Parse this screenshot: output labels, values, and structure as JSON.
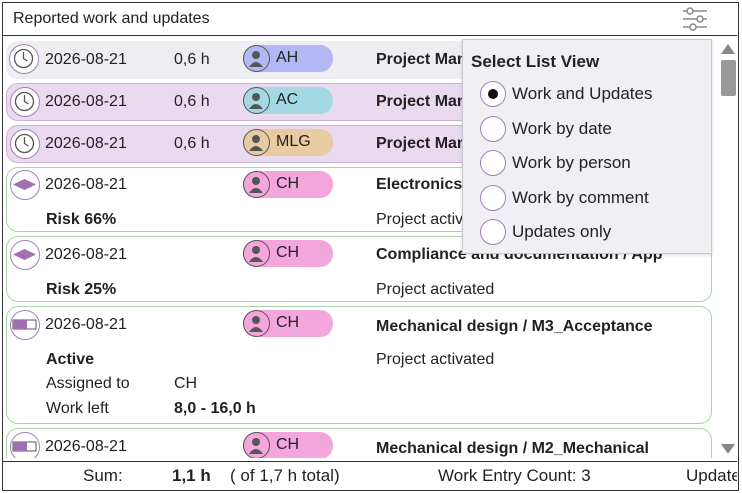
{
  "header": {
    "title": "Reported work and updates",
    "filter_icon": "filter-sliders-icon"
  },
  "rows": [
    {
      "kind": "work",
      "icon": "clock-icon",
      "date": "2026-08-21",
      "hours": "0,6 h",
      "initials": "AH",
      "pill_color": "#b3b8f4",
      "title": "Project Management"
    },
    {
      "kind": "work",
      "icon": "clock-icon",
      "date": "2026-08-21",
      "hours": "0,6 h",
      "initials": "AC",
      "pill_color": "#a3d9e3",
      "title": "Project Management"
    },
    {
      "kind": "work",
      "icon": "clock-icon",
      "date": "2026-08-21",
      "hours": "0,6 h",
      "initials": "MLG",
      "pill_color": "#e8cba0",
      "title": "Project Management"
    },
    {
      "kind": "update",
      "icon": "diamond-icon",
      "date": "2026-08-21",
      "initials": "CH",
      "pill_color": "#f2a6dc",
      "title": "Electronics",
      "status": "Risk 66%",
      "comment": "Project activated"
    },
    {
      "kind": "update",
      "icon": "diamond-icon",
      "date": "2026-08-21",
      "initials": "CH",
      "pill_color": "#f2a6dc",
      "title": "Compliance and documentation / App",
      "status": "Risk 25%",
      "comment": "Project activated"
    },
    {
      "kind": "update",
      "icon": "activity-bar-icon",
      "date": "2026-08-21",
      "initials": "CH",
      "pill_color": "#f2a6dc",
      "title": "Mechanical design / M3_Acceptance",
      "status": "Active",
      "comment": "Project activated",
      "assigned_label": "Assigned to",
      "assigned_value": "CH",
      "work_left_label": "Work left",
      "work_left_value": "8,0 - 16,0 h"
    },
    {
      "kind": "update",
      "icon": "activity-bar-icon",
      "date": "2026-08-21",
      "initials": "CH",
      "pill_color": "#f2a6dc",
      "title": "Mechanical design / M2_Mechanical"
    }
  ],
  "footer": {
    "sum_label": "Sum:",
    "sum_value": "1,1 h",
    "total": "( of 1,7 h total)",
    "count": "Work Entry Count: 3",
    "updates": "Update"
  },
  "popup": {
    "title": "Select List View",
    "options": [
      {
        "label": "Work and Updates",
        "selected": true
      },
      {
        "label": "Work by date",
        "selected": false
      },
      {
        "label": "Work by person",
        "selected": false
      },
      {
        "label": "Work by comment",
        "selected": false
      },
      {
        "label": "Updates only",
        "selected": false
      }
    ]
  },
  "colors": {
    "accent": "#a080b5",
    "work_bg": "#ededf2",
    "selected_bg": "#eadaf0",
    "update_border": "#a9d6a6"
  }
}
